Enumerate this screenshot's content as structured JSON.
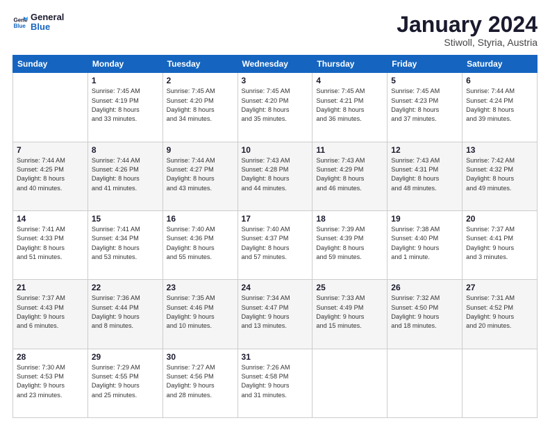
{
  "header": {
    "logo_line1": "General",
    "logo_line2": "Blue",
    "month": "January 2024",
    "location": "Stiwoll, Styria, Austria"
  },
  "weekdays": [
    "Sunday",
    "Monday",
    "Tuesday",
    "Wednesday",
    "Thursday",
    "Friday",
    "Saturday"
  ],
  "weeks": [
    [
      {
        "num": "",
        "info": ""
      },
      {
        "num": "1",
        "info": "Sunrise: 7:45 AM\nSunset: 4:19 PM\nDaylight: 8 hours\nand 33 minutes."
      },
      {
        "num": "2",
        "info": "Sunrise: 7:45 AM\nSunset: 4:20 PM\nDaylight: 8 hours\nand 34 minutes."
      },
      {
        "num": "3",
        "info": "Sunrise: 7:45 AM\nSunset: 4:20 PM\nDaylight: 8 hours\nand 35 minutes."
      },
      {
        "num": "4",
        "info": "Sunrise: 7:45 AM\nSunset: 4:21 PM\nDaylight: 8 hours\nand 36 minutes."
      },
      {
        "num": "5",
        "info": "Sunrise: 7:45 AM\nSunset: 4:23 PM\nDaylight: 8 hours\nand 37 minutes."
      },
      {
        "num": "6",
        "info": "Sunrise: 7:44 AM\nSunset: 4:24 PM\nDaylight: 8 hours\nand 39 minutes."
      }
    ],
    [
      {
        "num": "7",
        "info": "Sunrise: 7:44 AM\nSunset: 4:25 PM\nDaylight: 8 hours\nand 40 minutes."
      },
      {
        "num": "8",
        "info": "Sunrise: 7:44 AM\nSunset: 4:26 PM\nDaylight: 8 hours\nand 41 minutes."
      },
      {
        "num": "9",
        "info": "Sunrise: 7:44 AM\nSunset: 4:27 PM\nDaylight: 8 hours\nand 43 minutes."
      },
      {
        "num": "10",
        "info": "Sunrise: 7:43 AM\nSunset: 4:28 PM\nDaylight: 8 hours\nand 44 minutes."
      },
      {
        "num": "11",
        "info": "Sunrise: 7:43 AM\nSunset: 4:29 PM\nDaylight: 8 hours\nand 46 minutes."
      },
      {
        "num": "12",
        "info": "Sunrise: 7:43 AM\nSunset: 4:31 PM\nDaylight: 8 hours\nand 48 minutes."
      },
      {
        "num": "13",
        "info": "Sunrise: 7:42 AM\nSunset: 4:32 PM\nDaylight: 8 hours\nand 49 minutes."
      }
    ],
    [
      {
        "num": "14",
        "info": "Sunrise: 7:41 AM\nSunset: 4:33 PM\nDaylight: 8 hours\nand 51 minutes."
      },
      {
        "num": "15",
        "info": "Sunrise: 7:41 AM\nSunset: 4:34 PM\nDaylight: 8 hours\nand 53 minutes."
      },
      {
        "num": "16",
        "info": "Sunrise: 7:40 AM\nSunset: 4:36 PM\nDaylight: 8 hours\nand 55 minutes."
      },
      {
        "num": "17",
        "info": "Sunrise: 7:40 AM\nSunset: 4:37 PM\nDaylight: 8 hours\nand 57 minutes."
      },
      {
        "num": "18",
        "info": "Sunrise: 7:39 AM\nSunset: 4:39 PM\nDaylight: 8 hours\nand 59 minutes."
      },
      {
        "num": "19",
        "info": "Sunrise: 7:38 AM\nSunset: 4:40 PM\nDaylight: 9 hours\nand 1 minute."
      },
      {
        "num": "20",
        "info": "Sunrise: 7:37 AM\nSunset: 4:41 PM\nDaylight: 9 hours\nand 3 minutes."
      }
    ],
    [
      {
        "num": "21",
        "info": "Sunrise: 7:37 AM\nSunset: 4:43 PM\nDaylight: 9 hours\nand 6 minutes."
      },
      {
        "num": "22",
        "info": "Sunrise: 7:36 AM\nSunset: 4:44 PM\nDaylight: 9 hours\nand 8 minutes."
      },
      {
        "num": "23",
        "info": "Sunrise: 7:35 AM\nSunset: 4:46 PM\nDaylight: 9 hours\nand 10 minutes."
      },
      {
        "num": "24",
        "info": "Sunrise: 7:34 AM\nSunset: 4:47 PM\nDaylight: 9 hours\nand 13 minutes."
      },
      {
        "num": "25",
        "info": "Sunrise: 7:33 AM\nSunset: 4:49 PM\nDaylight: 9 hours\nand 15 minutes."
      },
      {
        "num": "26",
        "info": "Sunrise: 7:32 AM\nSunset: 4:50 PM\nDaylight: 9 hours\nand 18 minutes."
      },
      {
        "num": "27",
        "info": "Sunrise: 7:31 AM\nSunset: 4:52 PM\nDaylight: 9 hours\nand 20 minutes."
      }
    ],
    [
      {
        "num": "28",
        "info": "Sunrise: 7:30 AM\nSunset: 4:53 PM\nDaylight: 9 hours\nand 23 minutes."
      },
      {
        "num": "29",
        "info": "Sunrise: 7:29 AM\nSunset: 4:55 PM\nDaylight: 9 hours\nand 25 minutes."
      },
      {
        "num": "30",
        "info": "Sunrise: 7:27 AM\nSunset: 4:56 PM\nDaylight: 9 hours\nand 28 minutes."
      },
      {
        "num": "31",
        "info": "Sunrise: 7:26 AM\nSunset: 4:58 PM\nDaylight: 9 hours\nand 31 minutes."
      },
      {
        "num": "",
        "info": ""
      },
      {
        "num": "",
        "info": ""
      },
      {
        "num": "",
        "info": ""
      }
    ]
  ]
}
